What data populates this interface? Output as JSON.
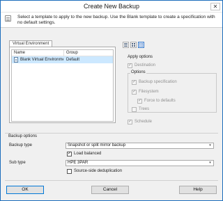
{
  "window": {
    "title": "Create New Backup",
    "close_glyph": "✕"
  },
  "header": {
    "description": "Select a template to apply to the new backup. Use the Blank template to create a specification with no default settings.",
    "icon": "template-info-icon"
  },
  "template_tab": {
    "label": "Virtual Environment",
    "columns": [
      "Name",
      "Group"
    ],
    "rows": [
      {
        "name": "Blank Virtual Environment",
        "group": "Default",
        "selected": true
      }
    ]
  },
  "view_toolbar": {
    "buttons": [
      "details-view-icon",
      "list-view-icon",
      "large-icons-view-icon"
    ],
    "active": "large-icons-view-icon"
  },
  "apply_options": {
    "title": "Apply options",
    "destination": {
      "label": "Destination",
      "checked": true,
      "enabled": false
    },
    "options_group": {
      "title": "Options",
      "backup_specification": {
        "label": "Backup specification",
        "checked": true,
        "enabled": false
      },
      "filesystem": {
        "label": "Filesystem",
        "checked": true,
        "enabled": false
      },
      "force_to_defaults": {
        "label": "Force to defaults",
        "checked": true,
        "enabled": false
      },
      "trees": {
        "label": "Trees",
        "checked": false,
        "enabled": false
      }
    },
    "schedule": {
      "label": "Schedule",
      "checked": true,
      "enabled": false
    }
  },
  "backup_options": {
    "title": "Backup options",
    "backup_type_label": "Backup type",
    "backup_type_value": "Snapshot or split mirror backup",
    "load_balanced": {
      "label": "Load balanced",
      "checked": true
    },
    "sub_type_label": "Sub type",
    "sub_type_value": "HPE 3PAR",
    "source_side_dedup": {
      "label": "Source-side deduplication",
      "checked": false
    }
  },
  "buttons": {
    "ok": "OK",
    "cancel": "Cancel",
    "help": "Help"
  },
  "glyphs": {
    "check": "✓",
    "dropdown": "▾"
  }
}
